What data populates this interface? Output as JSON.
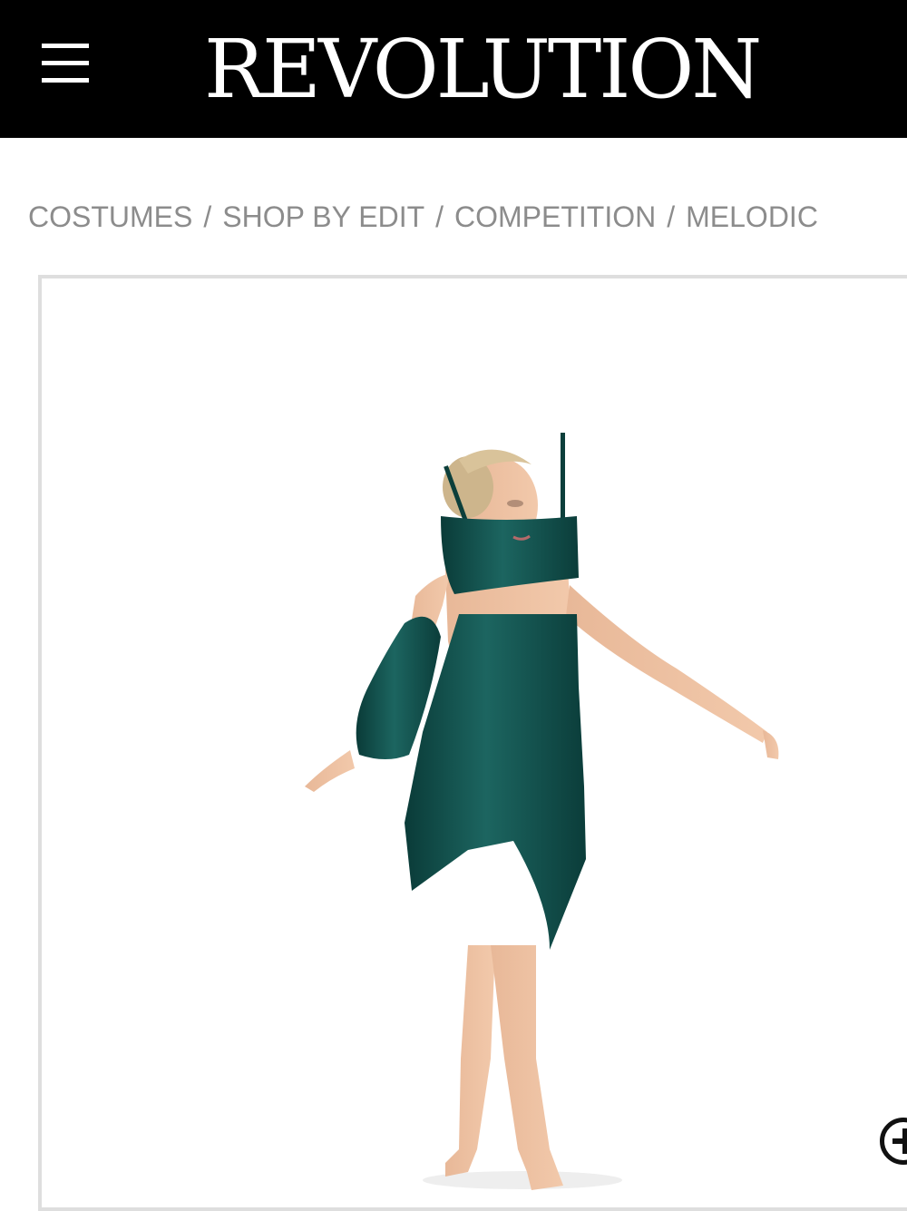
{
  "header": {
    "brand": "REVOLUTION",
    "menu_icon": "hamburger-menu-icon",
    "background_color": "#000000",
    "text_color": "#ffffff"
  },
  "breadcrumb": {
    "separator": "/",
    "items": [
      {
        "label": "COSTUMES"
      },
      {
        "label": "SHOP BY EDIT"
      },
      {
        "label": "COMPETITION"
      },
      {
        "label": "MELODIC"
      }
    ],
    "text_color": "#8c8c8c"
  },
  "product": {
    "image": "dancer-in-teal-satin-costume",
    "costume_color": "#0f4a46",
    "zoom_icon": "zoom-in-icon"
  }
}
